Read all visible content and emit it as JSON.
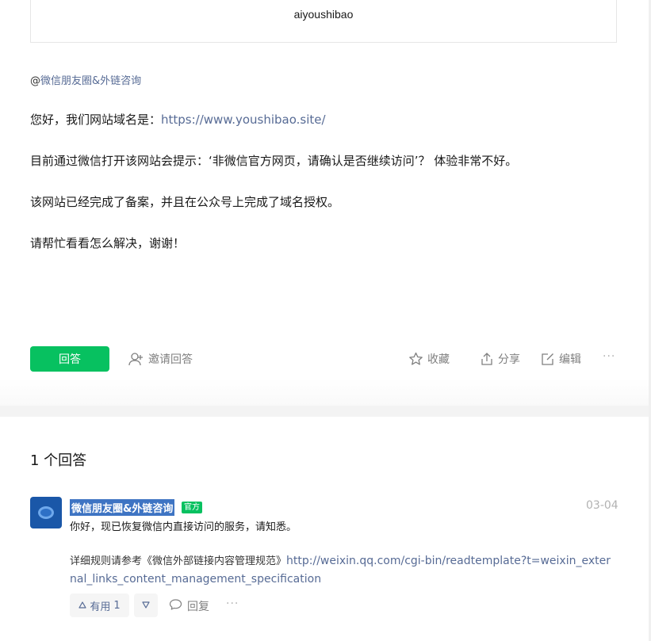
{
  "question": {
    "user_name": "aiyoushibao",
    "mention": {
      "at": "@",
      "target": "微信朋友圈&外链咨询"
    },
    "paragraphs": [
      {
        "text": "您好，我们网站域名是：",
        "link": "https://www.youshibao.site/"
      },
      {
        "text": "目前通过微信打开该网站会提示：‘非微信官方网页，请确认是否继续访问’？ 体验非常不好。"
      },
      {
        "text": "该网站已经完成了备案，并且在公众号上完成了域名授权。"
      },
      {
        "text": "请帮忙看看怎么解决，谢谢！"
      }
    ],
    "actions": {
      "answer": "回答",
      "invite": "邀请回答",
      "favorite": "收藏",
      "share": "分享",
      "edit": "编辑",
      "more": "···"
    }
  },
  "answers_section": {
    "heading": "1 个回答",
    "answers": [
      {
        "author": "微信朋友圈&外链咨询",
        "badge": "官方",
        "date": "03-04",
        "line1": "你好，现已恢复微信内直接访问的服务，请知悉。",
        "rules_prefix": "详细规则请参考《微信外部链接内容管理规范》",
        "rules_link": "http://weixin.qq.com/cgi-bin/readtemplate?t=weixin_external_links_content_management_specification",
        "useful_label": "有用",
        "useful_count": "1",
        "reply_label": "回复",
        "more": "···"
      }
    ]
  },
  "colors": {
    "accent_green": "#07c160",
    "link_blue": "#576b95",
    "selection_blue": "#3e74c3"
  },
  "icons": [
    "add-user-icon",
    "star-icon",
    "share-icon",
    "edit-icon",
    "thumb-up-icon",
    "thumb-down-icon",
    "comment-icon",
    "avatar-icon"
  ]
}
